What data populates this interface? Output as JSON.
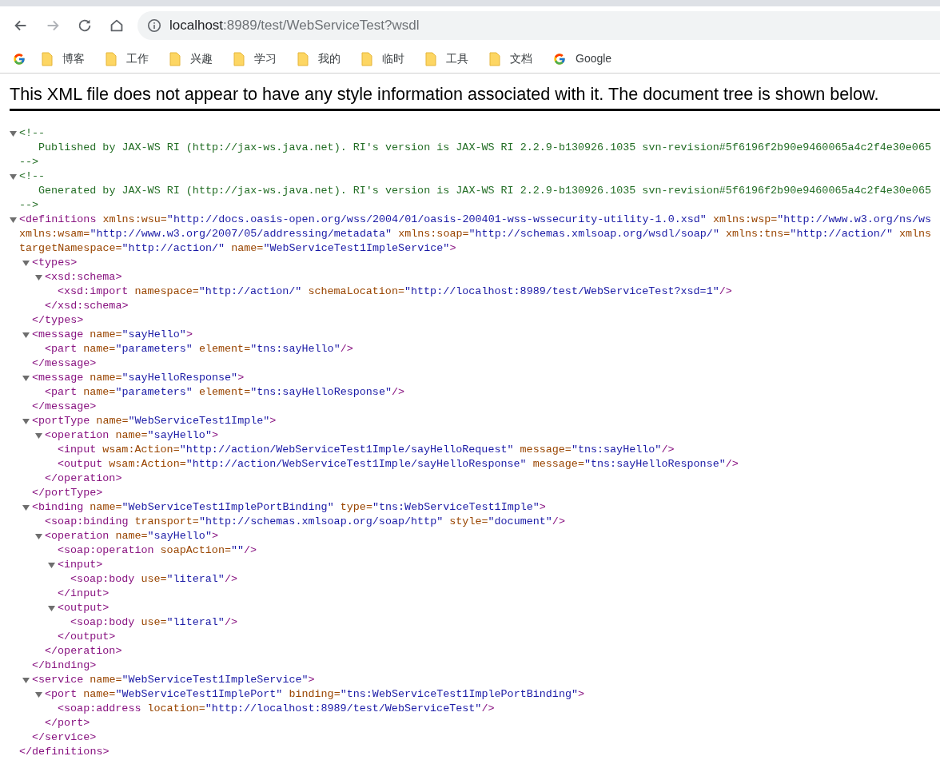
{
  "browser": {
    "nav_buttons": [
      {
        "kind": "back",
        "disabled": false
      },
      {
        "kind": "forward",
        "disabled": true
      },
      {
        "kind": "reload",
        "disabled": false
      },
      {
        "kind": "home",
        "disabled": false
      }
    ],
    "address": {
      "host": "localhost",
      "rest": ":8989/test/WebServiceTest?wsdl"
    },
    "bookmarks": [
      {
        "kind": "google"
      },
      {
        "kind": "folder",
        "label": "博客"
      },
      {
        "kind": "folder",
        "label": "工作"
      },
      {
        "kind": "folder",
        "label": "兴趣"
      },
      {
        "kind": "folder",
        "label": "学习"
      },
      {
        "kind": "folder",
        "label": "我的"
      },
      {
        "kind": "folder",
        "label": "临时"
      },
      {
        "kind": "folder",
        "label": "工具"
      },
      {
        "kind": "folder",
        "label": "文档"
      },
      {
        "kind": "google",
        "label": "Google"
      }
    ]
  },
  "notice": "This XML file does not appear to have any style information associated with it. The document tree is shown below.",
  "xml_tree": [
    {
      "kind": "comment",
      "expanded": true,
      "open": "<!--",
      "text": "Published by JAX-WS RI (http://jax-ws.java.net). RI's version is JAX-WS RI 2.2.9-b130926.1035 svn-revision#5f6196f2b90e9460065a4c2f4e30e065",
      "close": "-->"
    },
    {
      "kind": "comment",
      "expanded": true,
      "open": "<!--",
      "text": "Generated by JAX-WS RI (http://jax-ws.java.net). RI's version is JAX-WS RI 2.2.9-b130926.1035 svn-revision#5f6196f2b90e9460065a4c2f4e30e065",
      "close": "-->"
    },
    {
      "kind": "element",
      "expanded": true,
      "lines": [
        "<definitions xmlns:wsu=\"http://docs.oasis-open.org/wss/2004/01/oasis-200401-wss-wssecurity-utility-1.0.xsd\" xmlns:wsp=\"http://www.w3.org/ns/ws",
        "xmlns:wsam=\"http://www.w3.org/2007/05/addressing/metadata\" xmlns:soap=\"http://schemas.xmlsoap.org/wsdl/soap/\" xmlns:tns=\"http://action/\" xmlns",
        "targetNamespace=\"http://action/\" name=\"WebServiceTest1ImpleService\">"
      ],
      "close": "</definitions>",
      "children": [
        {
          "kind": "element",
          "expanded": true,
          "lines": [
            "<types>"
          ],
          "close": "</types>",
          "children": [
            {
              "kind": "element",
              "expanded": true,
              "lines": [
                "<xsd:schema>"
              ],
              "close": "</xsd:schema>",
              "children": [
                {
                  "kind": "element",
                  "lines": [
                    "<xsd:import namespace=\"http://action/\" schemaLocation=\"http://localhost:8989/test/WebServiceTest?xsd=1\"/>"
                  ]
                }
              ]
            }
          ]
        },
        {
          "kind": "element",
          "expanded": true,
          "lines": [
            "<message name=\"sayHello\">"
          ],
          "close": "</message>",
          "children": [
            {
              "kind": "element",
              "lines": [
                "<part name=\"parameters\" element=\"tns:sayHello\"/>"
              ]
            }
          ]
        },
        {
          "kind": "element",
          "expanded": true,
          "lines": [
            "<message name=\"sayHelloResponse\">"
          ],
          "close": "</message>",
          "children": [
            {
              "kind": "element",
              "lines": [
                "<part name=\"parameters\" element=\"tns:sayHelloResponse\"/>"
              ]
            }
          ]
        },
        {
          "kind": "element",
          "expanded": true,
          "lines": [
            "<portType name=\"WebServiceTest1Imple\">"
          ],
          "close": "</portType>",
          "children": [
            {
              "kind": "element",
              "expanded": true,
              "lines": [
                "<operation name=\"sayHello\">"
              ],
              "close": "</operation>",
              "children": [
                {
                  "kind": "element",
                  "lines": [
                    "<input wsam:Action=\"http://action/WebServiceTest1Imple/sayHelloRequest\" message=\"tns:sayHello\"/>"
                  ]
                },
                {
                  "kind": "element",
                  "lines": [
                    "<output wsam:Action=\"http://action/WebServiceTest1Imple/sayHelloResponse\" message=\"tns:sayHelloResponse\"/>"
                  ]
                }
              ]
            }
          ]
        },
        {
          "kind": "element",
          "expanded": true,
          "lines": [
            "<binding name=\"WebServiceTest1ImplePortBinding\" type=\"tns:WebServiceTest1Imple\">"
          ],
          "close": "</binding>",
          "children": [
            {
              "kind": "element",
              "lines": [
                "<soap:binding transport=\"http://schemas.xmlsoap.org/soap/http\" style=\"document\"/>"
              ]
            },
            {
              "kind": "element",
              "expanded": true,
              "lines": [
                "<operation name=\"sayHello\">"
              ],
              "close": "</operation>",
              "children": [
                {
                  "kind": "element",
                  "lines": [
                    "<soap:operation soapAction=\"\"/>"
                  ]
                },
                {
                  "kind": "element",
                  "expanded": true,
                  "lines": [
                    "<input>"
                  ],
                  "close": "</input>",
                  "children": [
                    {
                      "kind": "element",
                      "lines": [
                        "<soap:body use=\"literal\"/>"
                      ]
                    }
                  ]
                },
                {
                  "kind": "element",
                  "expanded": true,
                  "lines": [
                    "<output>"
                  ],
                  "close": "</output>",
                  "children": [
                    {
                      "kind": "element",
                      "lines": [
                        "<soap:body use=\"literal\"/>"
                      ]
                    }
                  ]
                }
              ]
            }
          ]
        },
        {
          "kind": "element",
          "expanded": true,
          "lines": [
            "<service name=\"WebServiceTest1ImpleService\">"
          ],
          "close": "</service>",
          "children": [
            {
              "kind": "element",
              "expanded": true,
              "lines": [
                "<port name=\"WebServiceTest1ImplePort\" binding=\"tns:WebServiceTest1ImplePortBinding\">"
              ],
              "close": "</port>",
              "children": [
                {
                  "kind": "element",
                  "lines": [
                    "<soap:address location=\"http://localhost:8989/test/WebServiceTest\"/>"
                  ]
                }
              ]
            }
          ]
        }
      ]
    }
  ]
}
